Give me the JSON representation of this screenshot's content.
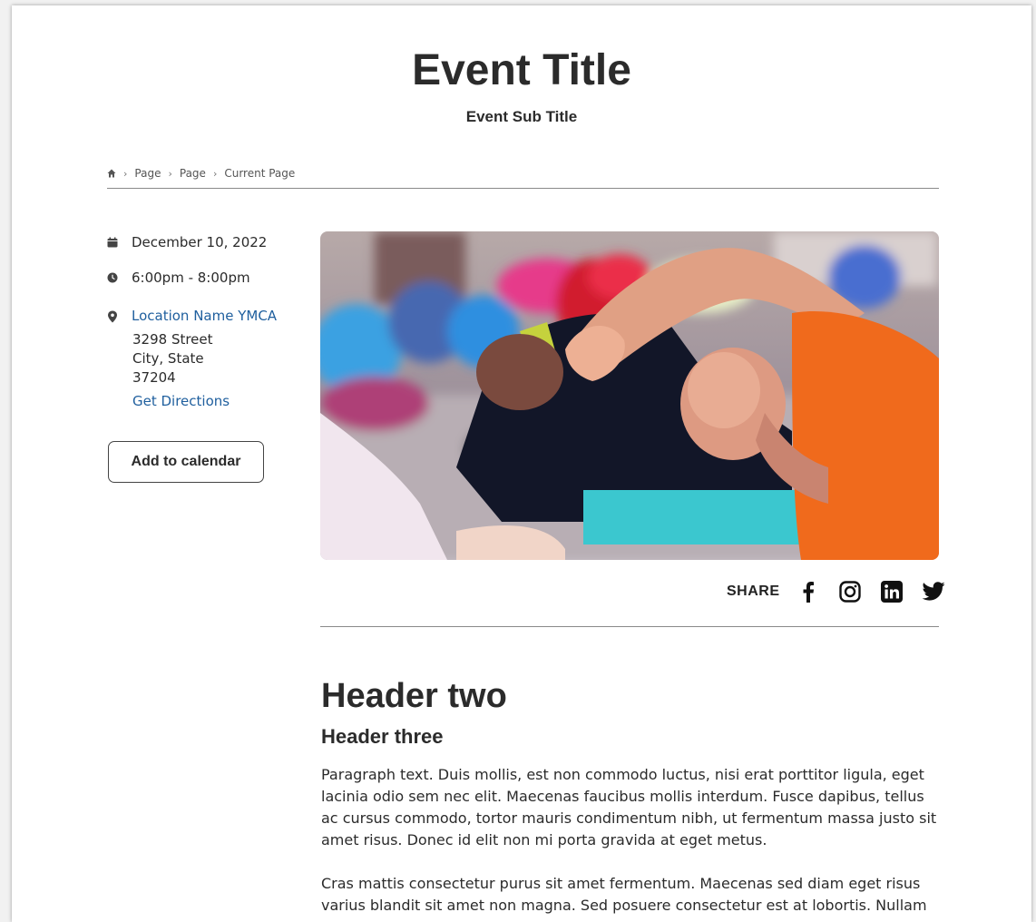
{
  "event": {
    "title": "Event Title",
    "subtitle": "Event Sub Title"
  },
  "breadcrumb": {
    "home_icon": "home-icon",
    "items": [
      "Page",
      "Page",
      "Current Page"
    ]
  },
  "details": {
    "date": "December 10, 2022",
    "time": "6:00pm - 8:00pm",
    "location_name": "Location Name YMCA",
    "address_line1": "3298 Street",
    "address_line2": "City, State",
    "address_line3": "37204",
    "directions_label": "Get Directions",
    "add_calendar_label": "Add to calendar"
  },
  "share": {
    "label": "SHARE",
    "icons": [
      "facebook-icon",
      "instagram-icon",
      "linkedin-icon",
      "twitter-icon"
    ]
  },
  "content": {
    "header_two": "Header two",
    "header_three": "Header three",
    "paragraph1": "Paragraph text. Duis mollis, est non commodo luctus, nisi erat porttitor ligula, eget lacinia odio sem nec elit. Maecenas faucibus mollis interdum. Fusce dapibus, tellus ac cursus commodo, tortor mauris condimentum nibh, ut fermentum massa justo sit amet risus. Donec id elit non mi porta gravida at eget metus.",
    "paragraph2": "Cras mattis consectetur purus sit amet fermentum. Maecenas sed diam eget risus varius blandit sit amet non magna. Sed posuere consectetur est at lobortis. Nullam"
  },
  "colors": {
    "link": "#1f5f9e",
    "text": "#2b2b2b",
    "accent_orange": "#ff6a1a"
  }
}
